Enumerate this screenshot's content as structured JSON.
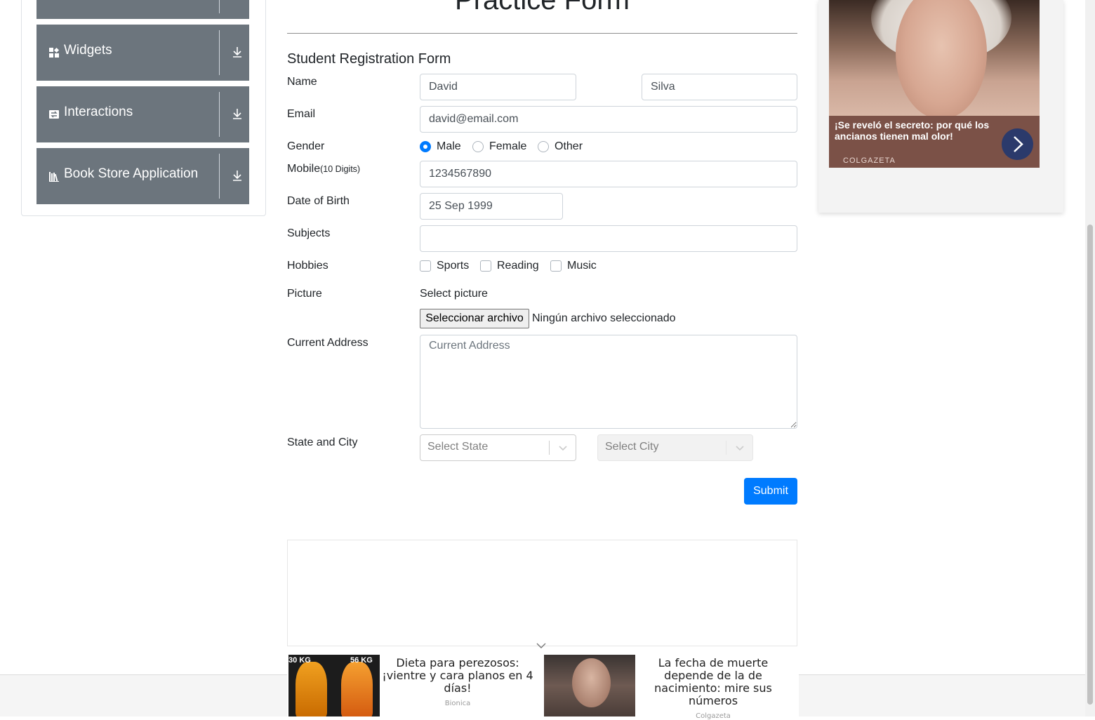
{
  "sidebar": {
    "groups": [
      {
        "label": "Widgets",
        "icon": "widgets-icon"
      },
      {
        "label": "Interactions",
        "icon": "interactions-icon"
      },
      {
        "label": "Book Store Application",
        "icon": "book-store-icon"
      }
    ]
  },
  "page": {
    "title": "Practice Form"
  },
  "form": {
    "heading": "Student Registration Form",
    "name_label": "Name",
    "first_name": "David",
    "last_name": "Silva",
    "email_label": "Email",
    "email": "david@email.com",
    "gender_label": "Gender",
    "genders": [
      "Male",
      "Female",
      "Other"
    ],
    "gender_selected": "Male",
    "mobile_label": "Mobile",
    "mobile_hint": "(10 Digits)",
    "mobile": "1234567890",
    "dob_label": "Date of Birth",
    "dob": "25 Sep 1999",
    "subjects_label": "Subjects",
    "hobbies_label": "Hobbies",
    "hobbies": [
      "Sports",
      "Reading",
      "Music"
    ],
    "picture_label": "Picture",
    "select_picture": "Select picture",
    "file_button": "Seleccionar archivo",
    "file_status": "Ningún archivo seleccionado",
    "address_label": "Current Address",
    "address_placeholder": "Current Address",
    "state_city_label": "State and City",
    "state_placeholder": "Select State",
    "city_placeholder": "Select City",
    "submit": "Submit"
  },
  "side_ad": {
    "caption": "¡Se reveló el secreto: por qué los ancianos tienen mal olor!",
    "brand": "COLGAZETA"
  },
  "bottom_ads": [
    {
      "title": "Dieta para perezosos: ¡vientre y cara planos en 4 días!",
      "source": "Bionica",
      "labels": [
        "30 KG",
        "56 KG"
      ]
    },
    {
      "title": "La fecha de muerte depende de la de nacimiento: mire sus números",
      "source": "Colgazeta"
    }
  ],
  "colors": {
    "primary": "#007bff",
    "sidebar_group": "#6c757d"
  }
}
